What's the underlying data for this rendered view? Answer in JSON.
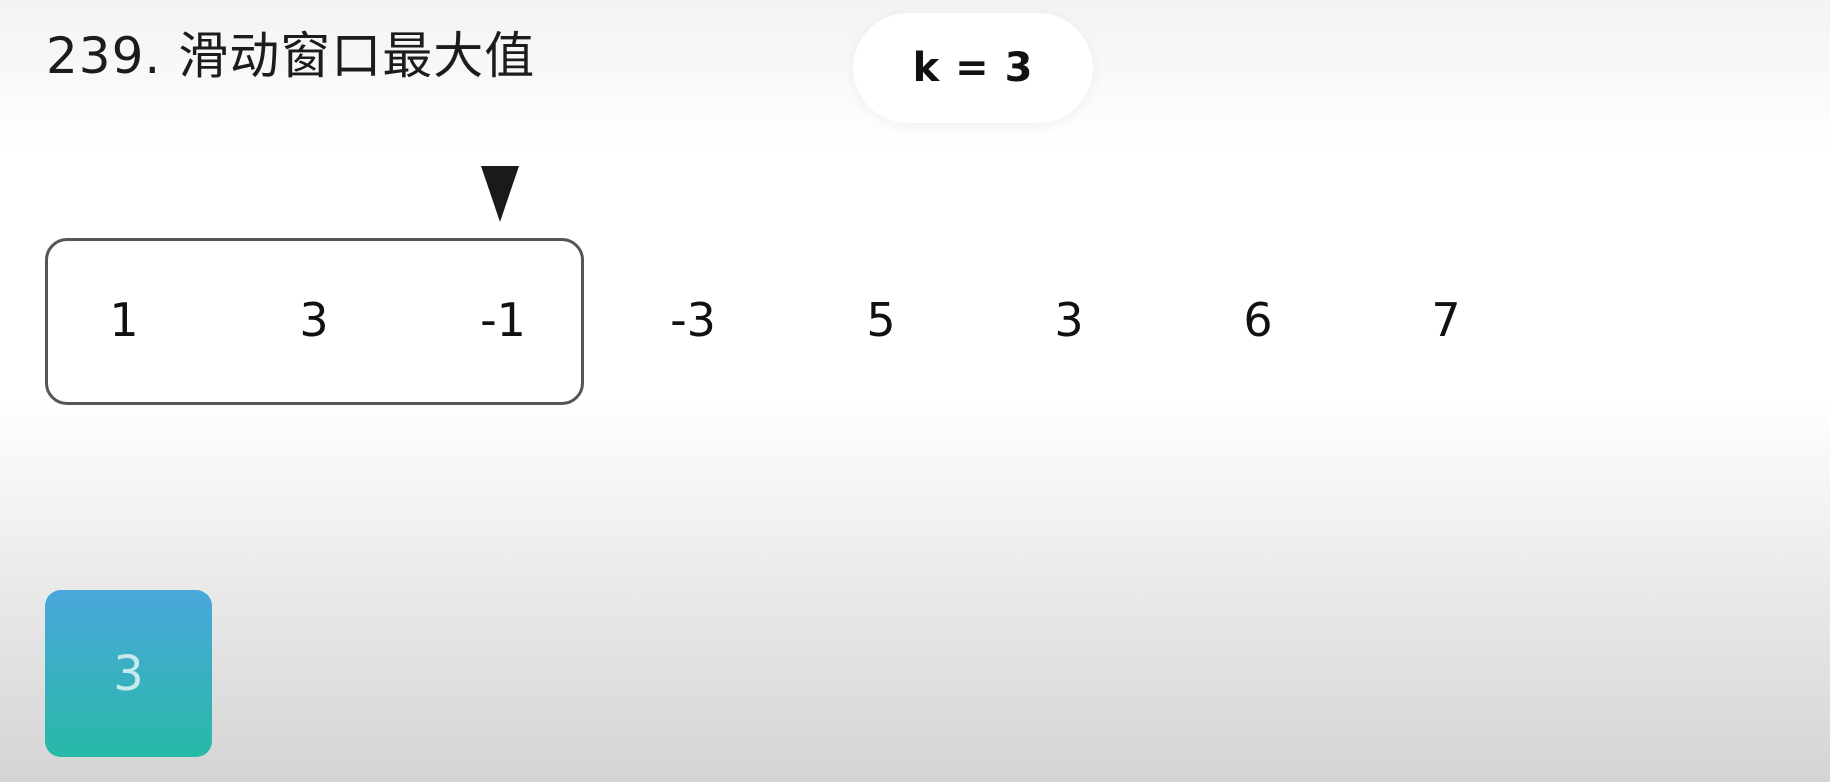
{
  "title": "239. 滑动窗口最大值",
  "k_label": "k = 3",
  "array": {
    "values": [
      "1",
      "3",
      "-1",
      "-3",
      "5",
      "3",
      "6",
      "7"
    ],
    "window_start_index": 0,
    "window_size": 3,
    "pointer_index": 2
  },
  "deque": {
    "items": [
      "3"
    ]
  },
  "colors": {
    "deque_top": "#4aa7dc",
    "deque_bottom": "#28b9a7",
    "window_border": "#555555",
    "pointer": "#1a1a1a"
  }
}
